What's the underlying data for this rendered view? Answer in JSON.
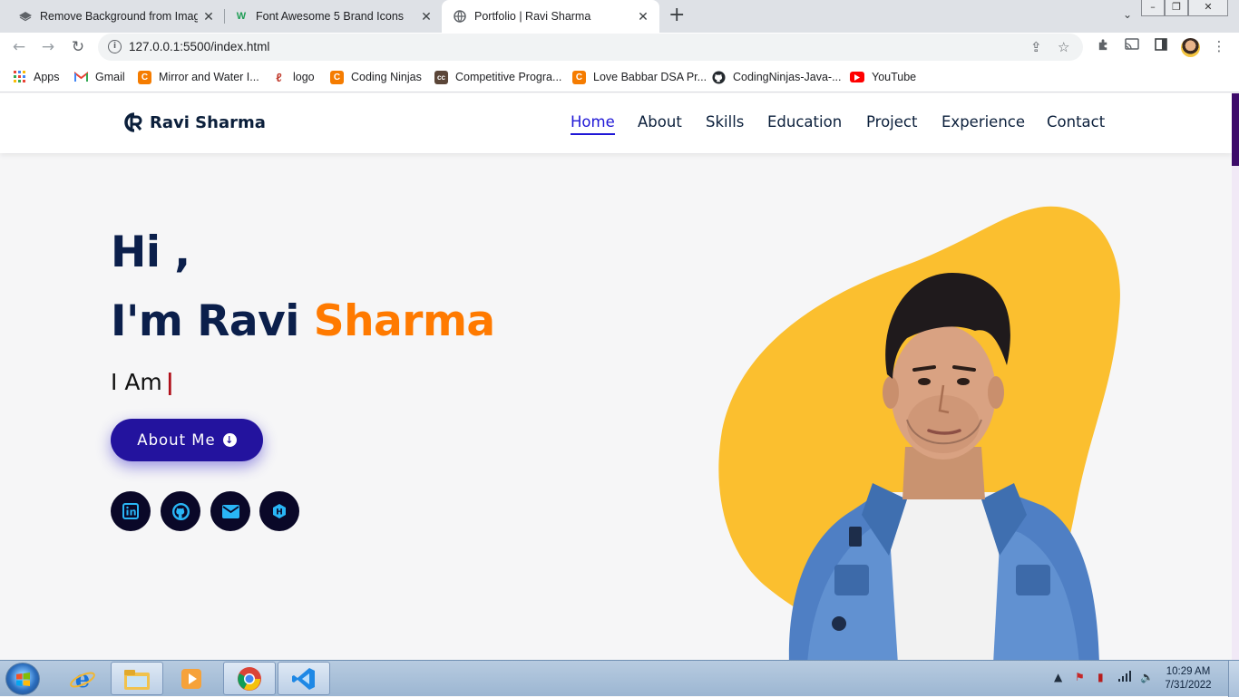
{
  "browser": {
    "tabs": [
      {
        "title": "Remove Background from Image",
        "icon": "layers-icon",
        "active": false
      },
      {
        "title": "Font Awesome 5 Brand Icons",
        "icon": "w-logo-icon",
        "active": false
      },
      {
        "title": "Portfolio | Ravi Sharma",
        "icon": "globe-icon",
        "active": true
      }
    ],
    "new_tab": "+",
    "url": "127.0.0.1:5500/index.html",
    "bookmarks": [
      {
        "label": "Apps",
        "icon": "apps-grid-icon"
      },
      {
        "label": "Gmail",
        "icon": "gmail-icon"
      },
      {
        "label": "Mirror and Water I...",
        "icon": "coding-ninjas-icon"
      },
      {
        "label": "logo",
        "icon": "logo-icon"
      },
      {
        "label": "Coding Ninjas",
        "icon": "coding-ninjas-icon"
      },
      {
        "label": "Competitive Progra...",
        "icon": "cc-icon"
      },
      {
        "label": "Love Babbar DSA Pr...",
        "icon": "coding-ninjas-icon"
      },
      {
        "label": "CodingNinjas-Java-...",
        "icon": "github-icon"
      },
      {
        "label": "YouTube",
        "icon": "youtube-icon"
      }
    ]
  },
  "site": {
    "brand": "Ravi Sharma",
    "nav": [
      "Home",
      "About",
      "Skills",
      "Education",
      "Project",
      "Experience",
      "Contact"
    ],
    "active_nav": "Home",
    "hero": {
      "greeting": "Hi ,",
      "intro_prefix": "I'm Ravi",
      "intro_accent": "Sharma",
      "typing_prefix": "I Am",
      "cursor": "|",
      "button_label": "About Me",
      "socials": [
        "linkedin-icon",
        "github-icon",
        "envelope-icon",
        "hashnode-icon"
      ]
    },
    "colors": {
      "navy": "#0b1f4b",
      "accent_orange": "#ff7a00",
      "active_blue": "#1f17d6",
      "button": "#23139e",
      "blob": "#fbbf2f"
    }
  },
  "taskbar": {
    "time": "10:29 AM",
    "date": "7/31/2022",
    "apps": [
      "internet-explorer-icon",
      "file-explorer-icon",
      "media-player-icon",
      "chrome-icon",
      "vscode-icon"
    ]
  }
}
